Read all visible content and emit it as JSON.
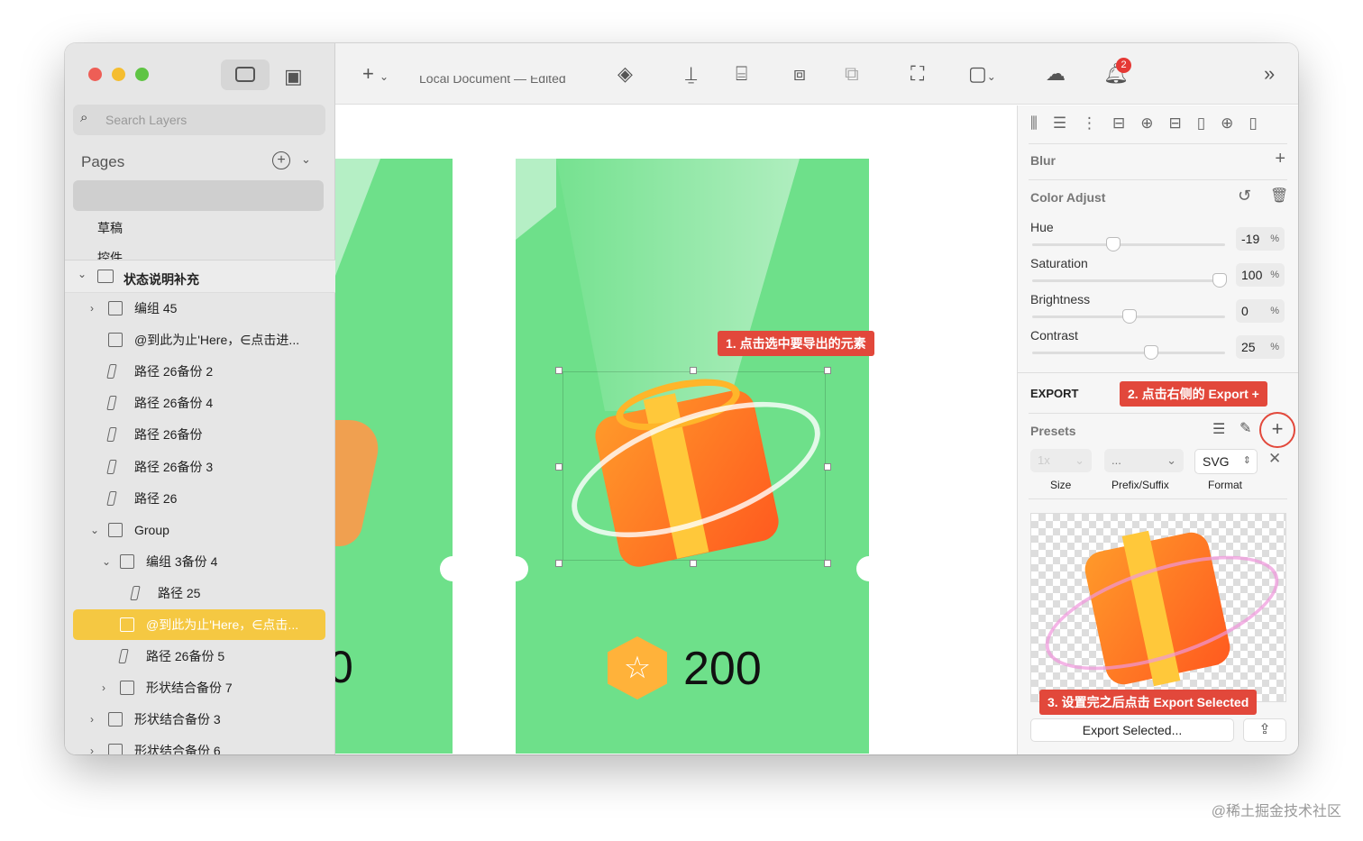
{
  "window": {
    "doc_title": "Local Document — Edited",
    "notification_count": "2"
  },
  "sidebar": {
    "search_placeholder": "Search Layers",
    "pages_label": "Pages",
    "pages": [
      "草稿",
      "控件"
    ],
    "group_header": "状态说明补充",
    "layers": [
      {
        "label": "编组 45",
        "indent": 0,
        "icon": "folder-icon",
        "caret": ">"
      },
      {
        "label": "@到此为止'Here，∈点击进...",
        "indent": 0,
        "icon": "image-icon",
        "caret": ""
      },
      {
        "label": "路径 26备份 2",
        "indent": 0,
        "icon": "path-icon",
        "caret": ""
      },
      {
        "label": "路径 26备份 4",
        "indent": 0,
        "icon": "path-icon",
        "caret": ""
      },
      {
        "label": "路径 26备份",
        "indent": 0,
        "icon": "path-icon",
        "caret": ""
      },
      {
        "label": "路径 26备份 3",
        "indent": 0,
        "icon": "path-icon",
        "caret": ""
      },
      {
        "label": "路径 26",
        "indent": 0,
        "icon": "path-icon",
        "caret": ""
      },
      {
        "label": "Group",
        "indent": 0,
        "icon": "folder-icon",
        "caret": "v"
      },
      {
        "label": "编组 3备份 4",
        "indent": 1,
        "icon": "folder-icon",
        "caret": "v"
      },
      {
        "label": "路径 25",
        "indent": 2,
        "icon": "path-icon",
        "caret": ""
      },
      {
        "label": "@到此为止'Here，∈点击...",
        "indent": 1,
        "icon": "image-icon",
        "caret": "",
        "selected": true
      },
      {
        "label": "路径 26备份 5",
        "indent": 1,
        "icon": "path-icon",
        "caret": ""
      },
      {
        "label": "形状结合备份 7",
        "indent": 1,
        "icon": "shape-icon",
        "caret": ">"
      },
      {
        "label": "形状结合备份 3",
        "indent": 0,
        "icon": "shape-icon",
        "caret": ">"
      },
      {
        "label": "形状结合备份 6",
        "indent": 0,
        "icon": "shape-icon",
        "caret": ">"
      }
    ]
  },
  "canvas": {
    "left_number": "0",
    "points": "200",
    "callout1": "1. 点击选中要导出的元素"
  },
  "inspector": {
    "blur": "Blur",
    "color_adjust": "Color Adjust",
    "sliders": [
      {
        "label": "Hue",
        "value": "-19",
        "unit": "%",
        "pos": 0.41
      },
      {
        "label": "Saturation",
        "value": "100",
        "unit": "%",
        "pos": 1.0
      },
      {
        "label": "Brightness",
        "value": "0",
        "unit": "%",
        "pos": 0.5
      },
      {
        "label": "Contrast",
        "value": "25",
        "unit": "%",
        "pos": 0.62
      }
    ],
    "export": "EXPORT",
    "callout2": "2. 点击右侧的 Export +",
    "presets": "Presets",
    "size_value": "1x",
    "prefix_value": "...",
    "format_value": "SVG",
    "size_label": "Size",
    "prefix_label": "Prefix/Suffix",
    "format_label": "Format",
    "callout3": "3. 设置完之后点击 Export Selected",
    "export_selected": "Export Selected..."
  },
  "watermark": "@稀土掘金技术社区",
  "colors": {
    "artboard": "#6ee08a",
    "callout": "#e2483b",
    "selected": "#f5c842"
  }
}
